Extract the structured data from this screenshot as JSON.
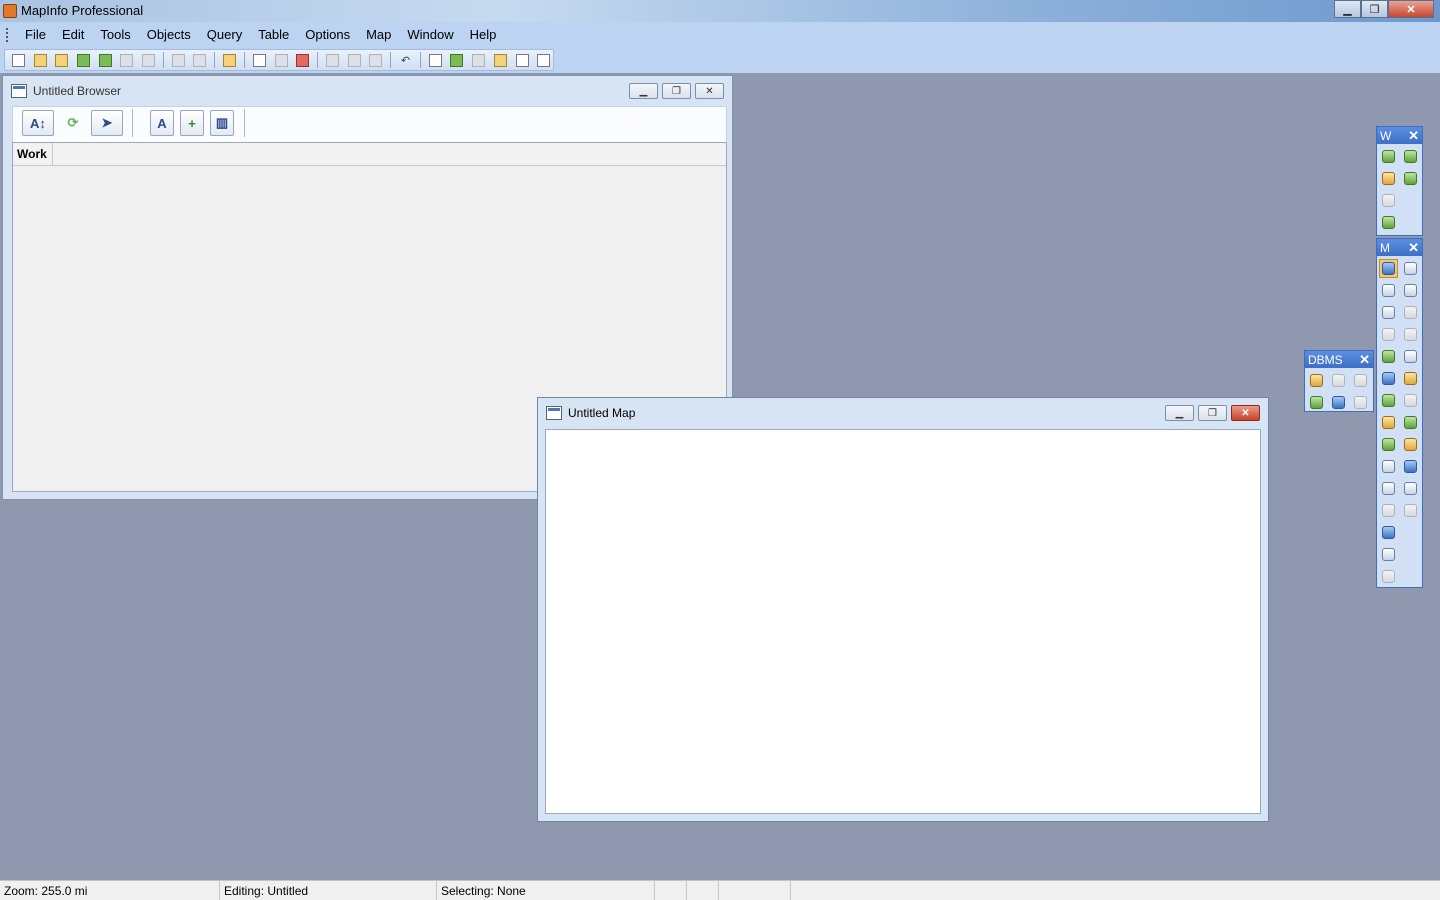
{
  "app": {
    "title": "MapInfo Professional"
  },
  "menu": [
    "File",
    "Edit",
    "Tools",
    "Objects",
    "Query",
    "Table",
    "Options",
    "Map",
    "Window",
    "Help"
  ],
  "browser": {
    "title": "Untitled Browser",
    "column_header": "Work"
  },
  "map": {
    "title": "Untitled Map"
  },
  "palettes": {
    "w": {
      "title": "W",
      "close": "✕"
    },
    "m": {
      "title": "M",
      "close": "✕"
    },
    "dbms": {
      "title": "DBMS",
      "close": "✕"
    }
  },
  "status": {
    "zoom": "Zoom: 255.0 mi",
    "editing": "Editing: Untitled",
    "selecting": "Selecting: None"
  }
}
